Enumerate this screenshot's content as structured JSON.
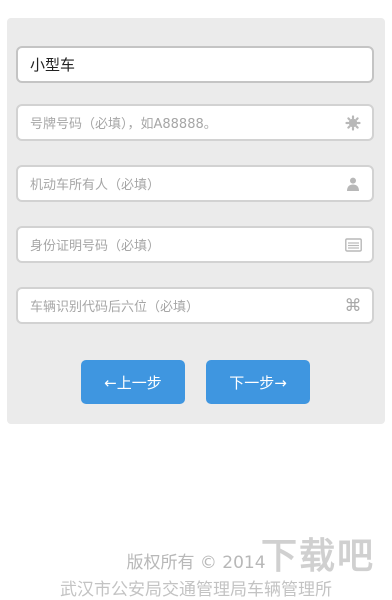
{
  "form": {
    "vehicle_type": {
      "value": "小型车"
    },
    "plate_number": {
      "placeholder": "号牌号码（必填），如A88888。",
      "icon": "gear-icon"
    },
    "owner_name": {
      "placeholder": "机动车所有人（必填）",
      "icon": "user-icon"
    },
    "id_number": {
      "placeholder": "身份证明号码（必填）",
      "icon": "id-card-icon"
    },
    "vin_suffix": {
      "placeholder": "车辆识别代码后六位（必填）",
      "icon": "command-icon"
    }
  },
  "buttons": {
    "prev_label": "←上一步",
    "next_label": "下一步→"
  },
  "footer": {
    "copyright": "版权所有 © 2014",
    "org": "武汉市公安局交通管理局车辆管理所"
  },
  "watermark": {
    "text": "下载吧"
  },
  "colors": {
    "accent": "#3f96e0",
    "panel": "#ebebeb"
  }
}
